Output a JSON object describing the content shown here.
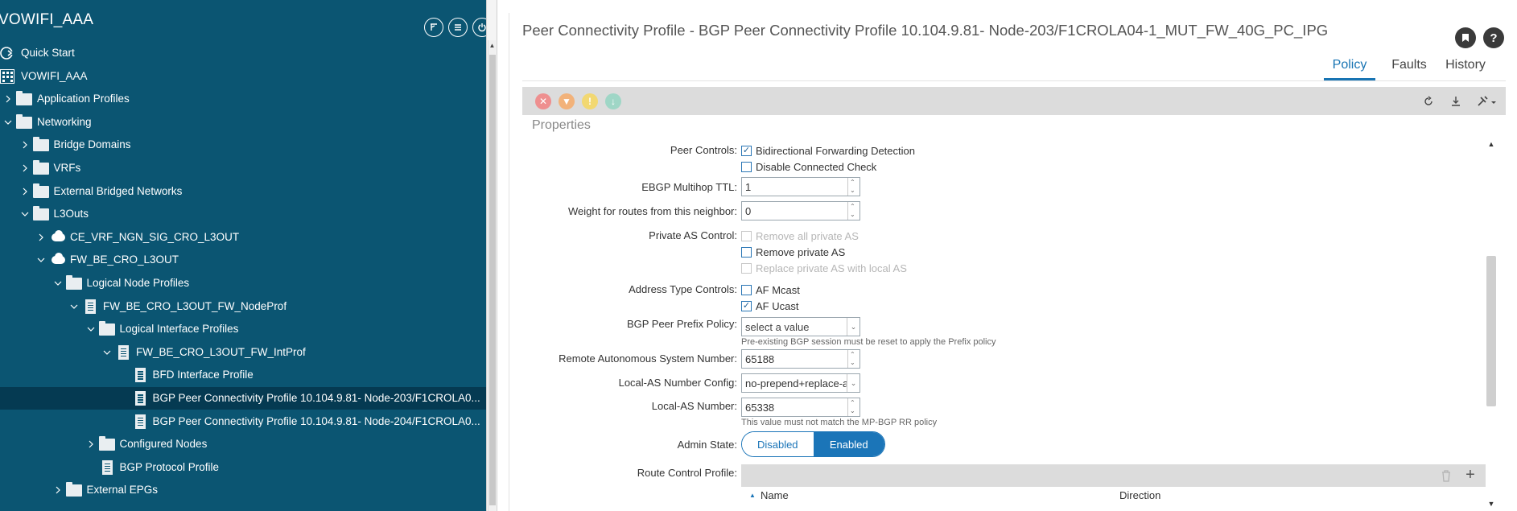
{
  "nav": {
    "title": "VOWIFI_AAA",
    "header_icons": [
      "filter-icon",
      "list-icon",
      "power-icon"
    ],
    "tree": [
      {
        "label": "Quick Start",
        "icon": "quick-start-icon",
        "level": 0,
        "chev": "none"
      },
      {
        "label": "VOWIFI_AAA",
        "icon": "tenant-icon",
        "level": 0,
        "chev": "none"
      },
      {
        "label": "Application Profiles",
        "icon": "folder-icon",
        "level": 0,
        "chev": "right"
      },
      {
        "label": "Networking",
        "icon": "folder-icon",
        "level": 0,
        "chev": "down"
      },
      {
        "label": "Bridge Domains",
        "icon": "folder-icon",
        "level": 1,
        "chev": "right"
      },
      {
        "label": "VRFs",
        "icon": "folder-icon",
        "level": 1,
        "chev": "right"
      },
      {
        "label": "External Bridged Networks",
        "icon": "folder-icon",
        "level": 1,
        "chev": "right"
      },
      {
        "label": "L3Outs",
        "icon": "folder-icon",
        "level": 1,
        "chev": "down"
      },
      {
        "label": "CE_VRF_NGN_SIG_CRO_L3OUT",
        "icon": "cloud-icon",
        "level": 2,
        "chev": "right"
      },
      {
        "label": "FW_BE_CRO_L3OUT",
        "icon": "cloud-icon",
        "level": 2,
        "chev": "down"
      },
      {
        "label": "Logical Node Profiles",
        "icon": "folder-icon",
        "level": 3,
        "chev": "down"
      },
      {
        "label": "FW_BE_CRO_L3OUT_FW_NodeProf",
        "icon": "document-icon",
        "level": 4,
        "chev": "down"
      },
      {
        "label": "Logical Interface Profiles",
        "icon": "folder-icon",
        "level": 5,
        "chev": "down"
      },
      {
        "label": "FW_BE_CRO_L3OUT_FW_IntProf",
        "icon": "document-icon",
        "level": 6,
        "chev": "down"
      },
      {
        "label": "BFD Interface Profile",
        "icon": "document-icon",
        "level": 7,
        "chev": "none"
      },
      {
        "label": "BGP Peer Connectivity Profile 10.104.9.81- Node-203/F1CROLA0...",
        "icon": "document-icon",
        "level": 7,
        "chev": "none",
        "selected": true
      },
      {
        "label": "BGP Peer Connectivity Profile 10.104.9.81- Node-204/F1CROLA0...",
        "icon": "document-icon",
        "level": 7,
        "chev": "none"
      },
      {
        "label": "Configured Nodes",
        "icon": "folder-icon",
        "level": 5,
        "chev": "right"
      },
      {
        "label": "BGP Protocol Profile",
        "icon": "document-icon",
        "level": 5,
        "chev": "none"
      },
      {
        "label": "External EPGs",
        "icon": "folder-icon",
        "level": 3,
        "chev": "right"
      }
    ]
  },
  "main": {
    "title": "Peer Connectivity Profile - BGP Peer Connectivity Profile 10.104.9.81- Node-203/F1CROLA04-1_MUT_FW_40G_PC_IPG",
    "tabs": [
      {
        "label": "Policy",
        "active": true
      },
      {
        "label": "Faults",
        "active": false
      },
      {
        "label": "History",
        "active": false
      }
    ],
    "section_title": "Properties",
    "peer_controls": {
      "label": "Peer Controls:",
      "options": [
        {
          "label": "Bidirectional Forwarding Detection",
          "checked": true
        },
        {
          "label": "Disable Connected Check",
          "checked": false
        }
      ]
    },
    "ebgp_multihop_ttl": {
      "label": "EBGP Multihop TTL:",
      "value": "1"
    },
    "weight": {
      "label": "Weight for routes from this neighbor:",
      "value": "0"
    },
    "private_as_control": {
      "label": "Private AS Control:",
      "options": [
        {
          "label": "Remove all private AS",
          "checked": false,
          "disabled": true
        },
        {
          "label": "Remove private AS",
          "checked": false,
          "disabled": false
        },
        {
          "label": "Replace private AS with local AS",
          "checked": false,
          "disabled": true
        }
      ]
    },
    "address_type_controls": {
      "label": "Address Type Controls:",
      "options": [
        {
          "label": "AF Mcast",
          "checked": false
        },
        {
          "label": "AF Ucast",
          "checked": true
        }
      ]
    },
    "bgp_peer_prefix_policy": {
      "label": "BGP Peer Prefix Policy:",
      "value": "select a value",
      "hint": "Pre-existing BGP session must be reset to apply the Prefix policy"
    },
    "remote_asn": {
      "label": "Remote Autonomous System Number:",
      "value": "65188"
    },
    "local_as_config": {
      "label": "Local-AS Number Config:",
      "value": "no-prepend+replace-as"
    },
    "local_as_number": {
      "label": "Local-AS Number:",
      "value": "65338",
      "hint": "This value must not match the MP-BGP RR policy"
    },
    "admin_state": {
      "label": "Admin State:",
      "off": "Disabled",
      "on": "Enabled",
      "selected": "Enabled"
    },
    "route_control_profile": {
      "label": "Route Control Profile:",
      "columns": [
        "Name",
        "Direction"
      ]
    }
  },
  "colors": {
    "nav_bg": "#0b5572",
    "nav_selected": "#053a52",
    "accent": "#1b75b8",
    "fault_critical": "#ee8f8f",
    "fault_major": "#f2b27a",
    "fault_minor": "#f2d872",
    "fault_warning": "#9fd6c6"
  }
}
